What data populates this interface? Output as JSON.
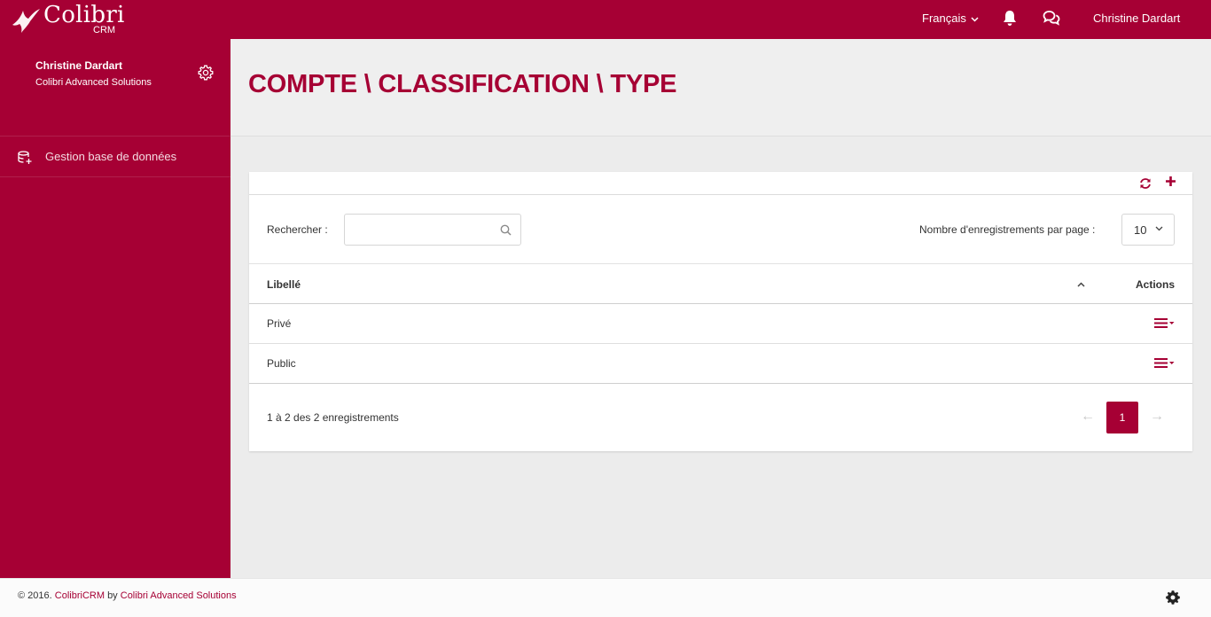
{
  "app": {
    "logo_name": "Colibri",
    "logo_sub": "CRM"
  },
  "topbar": {
    "language": "Français",
    "user": "Christine Dardart"
  },
  "sidebar": {
    "profile": {
      "name": "Christine Dardart",
      "company": "Colibri Advanced Solutions"
    },
    "items": [
      {
        "label": "Gestion base de données",
        "icon": "database-add-icon"
      }
    ]
  },
  "page": {
    "title": "COMPTE \\ CLASSIFICATION \\ TYPE"
  },
  "table": {
    "search_label": "Rechercher :",
    "search_value": "",
    "per_page_label": "Nombre d'enregistrements par page :",
    "per_page_value": "10",
    "columns": [
      "Libellé",
      "Actions"
    ],
    "rows": [
      {
        "label": "Privé"
      },
      {
        "label": "Public"
      }
    ],
    "info": "1 à 2 des 2 enregistrements",
    "pagination": {
      "prev": "←",
      "current": "1",
      "next": "→"
    }
  },
  "footer": {
    "prefix": "© 2016.",
    "brand": "ColibriCRM",
    "by": "by",
    "company": "Colibri Advanced Solutions"
  },
  "colors": {
    "brand": "#a60034",
    "background": "#ececec",
    "card": "#ffffff"
  }
}
